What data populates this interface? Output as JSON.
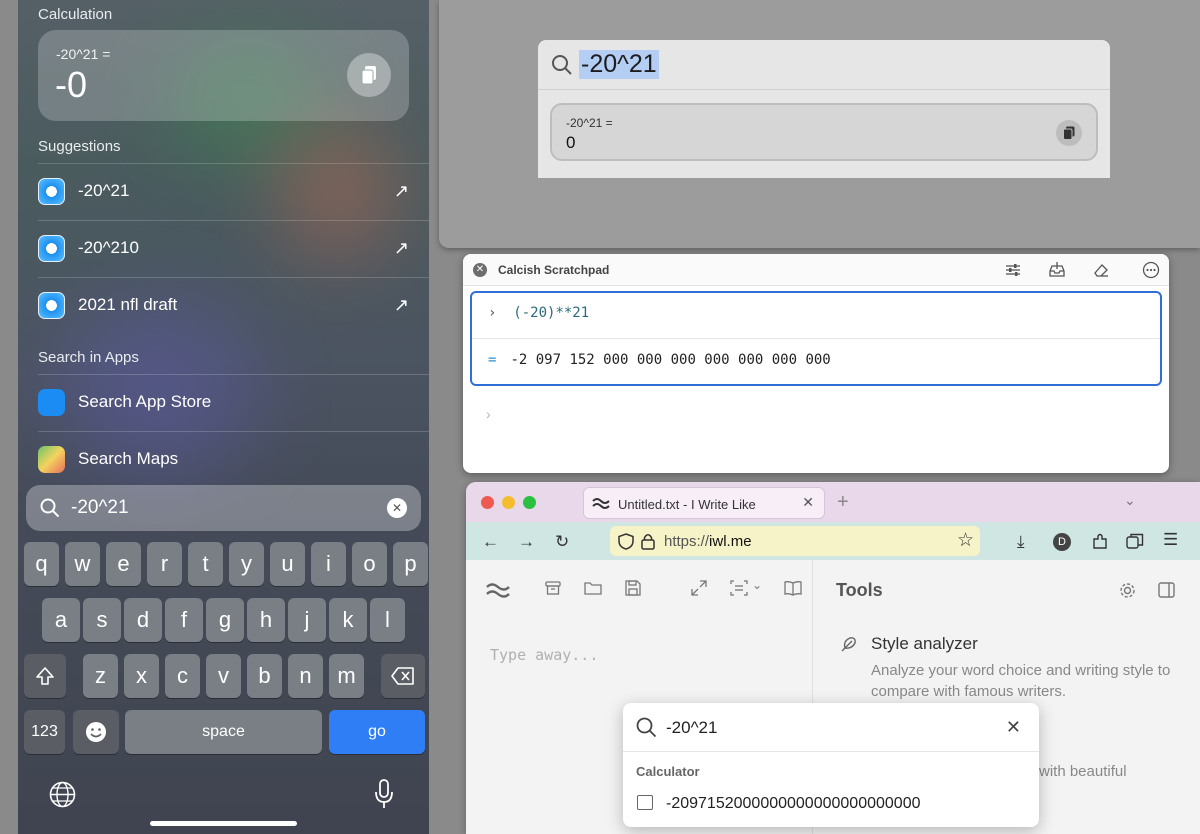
{
  "ios": {
    "calculation_heading": "Calculation",
    "calc_expression": "-20^21 =",
    "calc_result": "-0",
    "suggestions_heading": "Suggestions",
    "suggestions": [
      "-20^21",
      "-20^210",
      "2021 nfl draft"
    ],
    "search_in_apps_heading": "Search in Apps",
    "apps": [
      "Search App Store",
      "Search Maps"
    ],
    "search_query": "-20^21",
    "keyboard": {
      "row1": [
        "q",
        "w",
        "e",
        "r",
        "t",
        "y",
        "u",
        "i",
        "o",
        "p"
      ],
      "row2": [
        "a",
        "s",
        "d",
        "f",
        "g",
        "h",
        "j",
        "k",
        "l"
      ],
      "row3": [
        "z",
        "x",
        "c",
        "v",
        "b",
        "n",
        "m"
      ],
      "numbers": "123",
      "space": "space",
      "go": "go"
    }
  },
  "mac_spotlight": {
    "query": "-20^21",
    "expression": "-20^21 =",
    "result": "0"
  },
  "calcish": {
    "title": "Calcish Scratchpad",
    "input": "(-20)**21",
    "output": "-2 097 152 000 000 000 000 000 000 000"
  },
  "browser": {
    "tab_title": "Untitled.txt - I Write Like",
    "url_prefix": "https://",
    "url_host": "iwl.me",
    "editor_placeholder": "Type away...",
    "tools_heading": "Tools",
    "style_analyzer_title": "Style analyzer",
    "style_analyzer_desc": "Analyze your word choice and writing style to compare with famous writers.",
    "partial_text": "with beautiful"
  },
  "popup": {
    "query": "-20^21",
    "category": "Calculator",
    "result": "-2097152000000000000000000000"
  },
  "colors": {
    "selection": "#b3cdf3",
    "accent_blue": "#2f6fd6",
    "go_button": "#2f7ef6"
  }
}
